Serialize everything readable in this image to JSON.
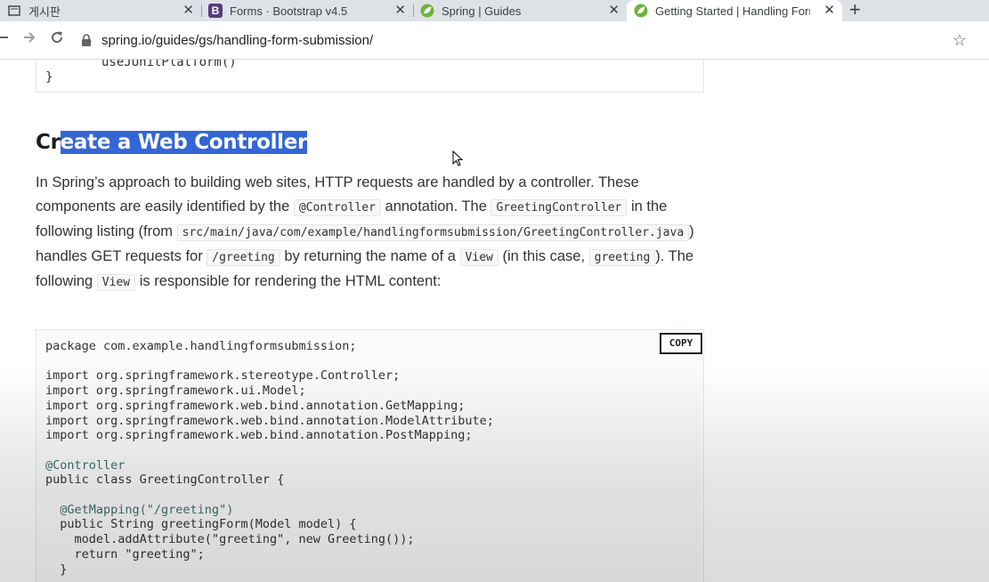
{
  "browser": {
    "tabs": [
      {
        "title": "게시판"
      },
      {
        "title": "Forms · Bootstrap v4.5",
        "favicon": "B"
      },
      {
        "title": "Spring | Guides"
      },
      {
        "title": "Getting Started | Handling Form"
      }
    ],
    "close_glyph": "✕",
    "new_tab_glyph": "+",
    "url": "spring.io/guides/gs/handling-form-submission/"
  },
  "page": {
    "top_code": {
      "line1": "useJUnitPlatform()",
      "line2": "}"
    },
    "heading_prefix": "Cr",
    "heading_selected": "eate a Web Controller",
    "para": {
      "t1": "In Spring’s approach to building web sites, HTTP requests are handled by a controller. These components are easily identified by the ",
      "c1": "@Controller",
      "t2": " annotation. The ",
      "c2": "GreetingController",
      "t3": " in the following listing (from ",
      "c3": "src/main/java/com/example/handlingformsubmission/GreetingController.java",
      "t4": ") handles GET requests for ",
      "c4": "/greeting",
      "t5": " by returning the name of a ",
      "c5": "View",
      "t6": " (in this case, ",
      "c6": "greeting",
      "t7": "). The following ",
      "c7": "View",
      "t8": " is responsible for rendering the HTML content:"
    },
    "copy_label": "COPY",
    "code_lines": [
      "package com.example.handlingformsubmission;",
      "",
      "import org.springframework.stereotype.Controller;",
      "import org.springframework.ui.Model;",
      "import org.springframework.web.bind.annotation.GetMapping;",
      "import org.springframework.web.bind.annotation.ModelAttribute;",
      "import org.springframework.web.bind.annotation.PostMapping;",
      "",
      "@Controller",
      "public class GreetingController {",
      "",
      "  @GetMapping(\"/greeting\")",
      "  public String greetingForm(Model model) {",
      "    model.addAttribute(\"greeting\", new Greeting());",
      "    return \"greeting\";",
      "  }"
    ]
  }
}
